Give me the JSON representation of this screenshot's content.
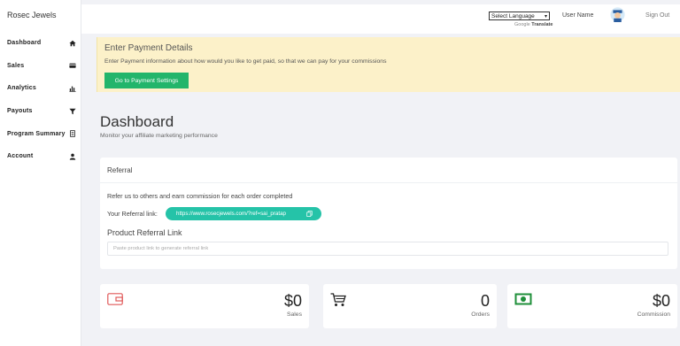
{
  "brand": "Rosec Jewels",
  "sidebar": {
    "items": [
      {
        "label": "Dashboard",
        "icon": "home-icon"
      },
      {
        "label": "Sales",
        "icon": "card-icon"
      },
      {
        "label": "Analytics",
        "icon": "bar-chart-icon"
      },
      {
        "label": "Payouts",
        "icon": "filter-icon"
      },
      {
        "label": "Program Summary",
        "icon": "document-icon"
      },
      {
        "label": "Account",
        "icon": "user-icon"
      }
    ]
  },
  "topbar": {
    "language_select": "Select Language",
    "powered_prefix": "Google",
    "powered_suffix": "Translate",
    "user_name": "User Name",
    "sign_out": "Sign Out"
  },
  "banner": {
    "title": "Enter Payment Details",
    "text": "Enter Payment information about how would you like to get paid, so that we can pay for your commissions",
    "button": "Go to Payment Settings"
  },
  "dashboard": {
    "title": "Dashboard",
    "subtitle": "Monitor your affiliate marketing performance"
  },
  "referral": {
    "header": "Referral",
    "description": "Refer us to others and earn commission for each order completed",
    "link_label": "Your Referral link:",
    "link_value": "https://www.rosecjewels.com/?ref=sai_pratap",
    "product_title": "Product Referral Link",
    "product_placeholder": "Paste product link to generate referral link"
  },
  "stats": [
    {
      "value": "$0",
      "label": "Sales",
      "icon": "wallet-icon"
    },
    {
      "value": "0",
      "label": "Orders",
      "icon": "cart-icon"
    },
    {
      "value": "$0",
      "label": "Commission",
      "icon": "cash-icon"
    }
  ],
  "colors": {
    "accent_green": "#22b56b",
    "link_pill": "#25c3a8",
    "banner_bg": "#fcf1c9",
    "wallet_red": "#e05a5a"
  }
}
